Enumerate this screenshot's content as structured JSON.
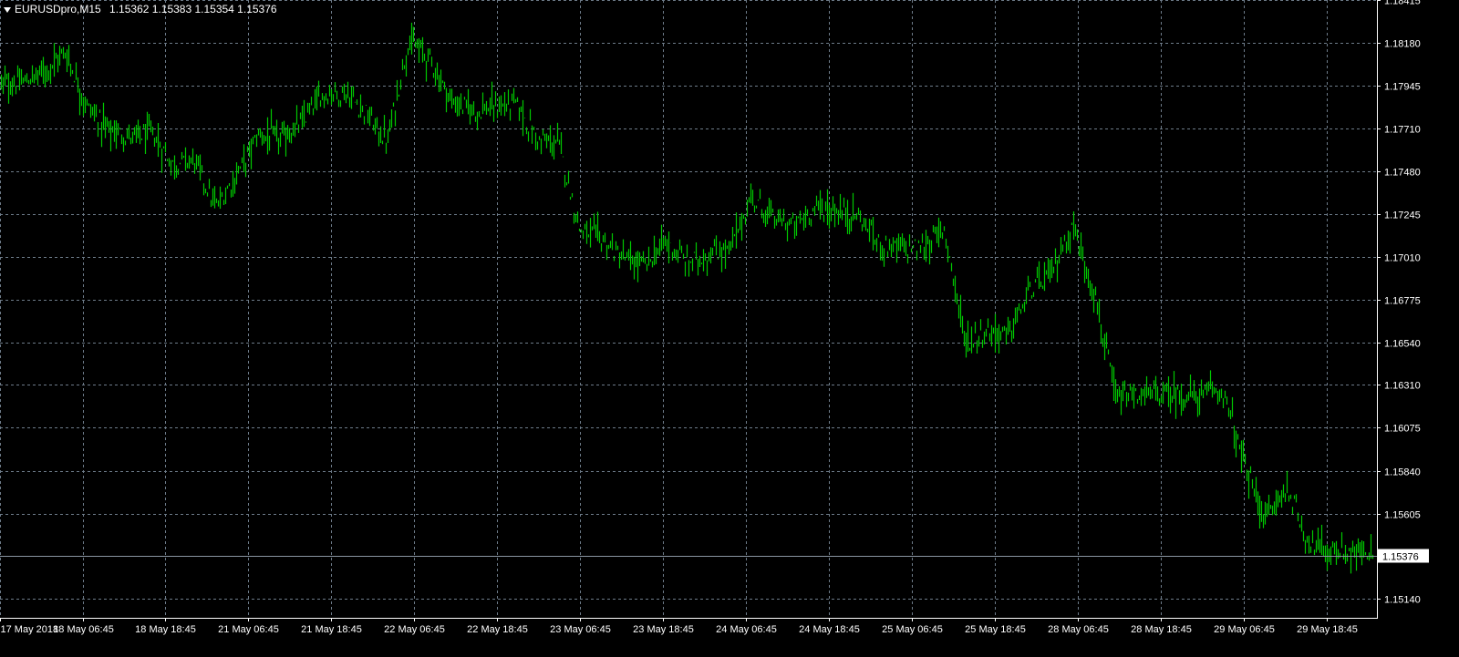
{
  "header": {
    "symbol": "EURUSDpro,M15",
    "ohlc": "1.15362 1.15383 1.15354 1.15376"
  },
  "colors": {
    "background": "#000000",
    "grid": "#6e7c8a",
    "bars": "#00c800",
    "axis_text": "#ffffff",
    "price_line": "#8a96a2"
  },
  "chart_data": {
    "type": "line",
    "title": "EURUSDpro,M15",
    "timeframe": "M15",
    "grid": true,
    "current_price": 1.15376,
    "current_price_label": "1.15376",
    "ylim": [
      1.15035,
      1.18415
    ],
    "y_ticks": [
      "1.18415",
      "1.18180",
      "1.17945",
      "1.17710",
      "1.17480",
      "1.17245",
      "1.17010",
      "1.16775",
      "1.16540",
      "1.16310",
      "1.16075",
      "1.15840",
      "1.15605",
      "1.15140"
    ],
    "x_ticks": [
      "17 May 2018",
      "18 May 06:45",
      "18 May 18:45",
      "21 May 06:45",
      "21 May 18:45",
      "22 May 06:45",
      "22 May 18:45",
      "23 May 06:45",
      "23 May 18:45",
      "24 May 06:45",
      "24 May 18:45",
      "25 May 06:45",
      "25 May 18:45",
      "28 May 06:45",
      "28 May 18:45",
      "29 May 06:45",
      "29 May 18:45"
    ],
    "series": [
      {
        "x": [
          "17 May 2018",
          "17 May 18:00",
          "18 May 00:00",
          "18 May 06:45",
          "18 May 09:00",
          "18 May 12:00",
          "18 May 15:00",
          "18 May 18:45",
          "18 May 21:00",
          "21 May 00:00",
          "21 May 03:00",
          "21 May 06:45",
          "21 May 09:00",
          "21 May 12:00",
          "21 May 15:00",
          "21 May 18:45",
          "21 May 21:00",
          "22 May 00:00",
          "22 May 03:00",
          "22 May 06:45",
          "22 May 09:00",
          "22 May 12:00",
          "22 May 15:00",
          "22 May 18:45",
          "22 May 21:00",
          "23 May 00:00",
          "23 May 03:00",
          "23 May 06:45",
          "23 May 09:00",
          "23 May 12:00",
          "23 May 15:00",
          "23 May 18:45",
          "23 May 21:00",
          "24 May 00:00",
          "24 May 03:00",
          "24 May 06:45",
          "24 May 09:00",
          "24 May 12:00",
          "24 May 15:00",
          "24 May 18:45",
          "24 May 21:00",
          "25 May 00:00",
          "25 May 03:00",
          "25 May 06:45",
          "25 May 09:00",
          "25 May 12:00",
          "25 May 15:00",
          "25 May 18:45",
          "25 May 21:00",
          "28 May 00:00",
          "28 May 03:00",
          "28 May 06:45",
          "28 May 09:00",
          "28 May 12:00",
          "28 May 15:00",
          "28 May 18:45",
          "28 May 21:00",
          "29 May 00:00",
          "29 May 03:00",
          "29 May 06:45",
          "29 May 09:00",
          "29 May 12:00",
          "29 May 15:00",
          "29 May 18:45",
          "29 May 20:00"
        ],
        "y": [
          1.1796,
          1.1796,
          1.1803,
          1.1813,
          1.1783,
          1.1771,
          1.1766,
          1.1769,
          1.1752,
          1.1754,
          1.1728,
          1.1746,
          1.1768,
          1.1765,
          1.1774,
          1.179,
          1.1791,
          1.178,
          1.1763,
          1.1819,
          1.1809,
          1.1786,
          1.1781,
          1.1782,
          1.1785,
          1.1765,
          1.1763,
          1.1716,
          1.1711,
          1.17,
          1.1696,
          1.1709,
          1.1698,
          1.1702,
          1.1705,
          1.1733,
          1.1722,
          1.1718,
          1.1728,
          1.1726,
          1.1723,
          1.1708,
          1.1706,
          1.1706,
          1.1717,
          1.1654,
          1.166,
          1.1659,
          1.1682,
          1.1692,
          1.1718,
          1.1682,
          1.1623,
          1.1625,
          1.1626,
          1.1625,
          1.1625,
          1.1628,
          1.1587,
          1.1558,
          1.1575,
          1.1545,
          1.154,
          1.1539,
          1.1538
        ]
      }
    ]
  }
}
